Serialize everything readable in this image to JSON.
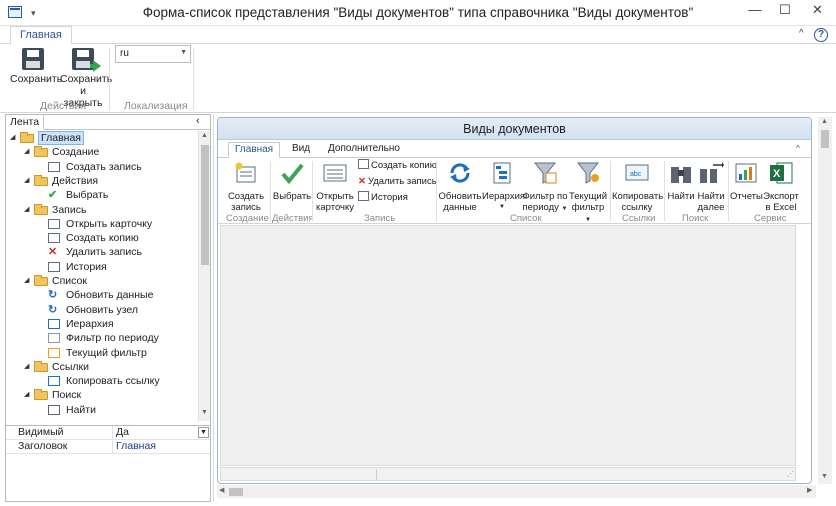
{
  "window": {
    "title": "Форма-список представления \"Виды документов\" типа справочника \"Виды документов\"",
    "minimize_glyph": "—",
    "maximize_glyph": "☐",
    "close_glyph": "✕",
    "quick_access_glyph": "▾"
  },
  "ribbon": {
    "tab_active": "Главная",
    "help_glyph": "?",
    "collapse_glyph": "^",
    "save_label": "Сохранить",
    "save_close_label_1": "Сохранить",
    "save_close_label_2": "и закрыть",
    "group_actions": "Действия",
    "lang_value": "ru",
    "group_localization": "Локализация"
  },
  "left_panel": {
    "tab_label": "Лента",
    "collapse_glyph": "‹",
    "tree": [
      {
        "label": "Главная",
        "level": 0,
        "icon": "folder-icon",
        "expanded": true,
        "selected": true
      },
      {
        "label": "Создание",
        "level": 1,
        "icon": "folder-icon",
        "expanded": true
      },
      {
        "label": "Создать запись",
        "level": 2,
        "icon": "create-record-icon"
      },
      {
        "label": "Действия",
        "level": 1,
        "icon": "folder-icon",
        "expanded": true
      },
      {
        "label": "Выбрать",
        "level": 2,
        "icon": "checkmark-icon"
      },
      {
        "label": "Запись",
        "level": 1,
        "icon": "folder-icon",
        "expanded": true
      },
      {
        "label": "Открыть карточку",
        "level": 2,
        "icon": "card-icon"
      },
      {
        "label": "Создать копию",
        "level": 2,
        "icon": "copy-icon"
      },
      {
        "label": "Удалить запись",
        "level": 2,
        "icon": "delete-icon"
      },
      {
        "label": "История",
        "level": 2,
        "icon": "history-icon"
      },
      {
        "label": "Список",
        "level": 1,
        "icon": "folder-icon",
        "expanded": true
      },
      {
        "label": "Обновить данные",
        "level": 2,
        "icon": "refresh-icon"
      },
      {
        "label": "Обновить узел",
        "level": 2,
        "icon": "refresh-icon"
      },
      {
        "label": "Иерархия",
        "level": 2,
        "icon": "hierarchy-icon"
      },
      {
        "label": "Фильтр по периоду",
        "level": 2,
        "icon": "filter-period-icon"
      },
      {
        "label": "Текущий фильтр",
        "level": 2,
        "icon": "filter-current-icon"
      },
      {
        "label": "Ссылки",
        "level": 1,
        "icon": "folder-icon",
        "expanded": true
      },
      {
        "label": "Копировать ссылку",
        "level": 2,
        "icon": "link-icon"
      },
      {
        "label": "Поиск",
        "level": 1,
        "icon": "folder-icon",
        "expanded": true
      },
      {
        "label": "Найти",
        "level": 2,
        "icon": "binoculars-icon"
      }
    ],
    "properties": [
      {
        "key": "Видимый",
        "value": "Да",
        "dropdown": true
      },
      {
        "key": "Заголовок",
        "value": "Главная",
        "dropdown": false
      }
    ]
  },
  "form": {
    "title": "Виды документов",
    "tabs": [
      "Главная",
      "Вид",
      "Дополнительно"
    ],
    "collapse_glyph": "^",
    "buttons": {
      "create_1": "Создать",
      "create_2": "запись",
      "select": "Выбрать",
      "open_1": "Открыть",
      "open_2": "карточку",
      "copy": "Создать копию",
      "delete": "Удалить запись",
      "history": "История",
      "refresh_1": "Обновить",
      "refresh_2": "данные",
      "hierarchy": "Иерархия",
      "filter_period_1": "Фильтр по",
      "filter_period_2": "периоду",
      "filter_current_1": "Текущий",
      "filter_current_2": "фильтр",
      "copy_link_1": "Копировать",
      "copy_link_2": "ссылку",
      "find": "Найти",
      "find_next_1": "Найти",
      "find_next_2": "далее",
      "reports": "Отчеты",
      "excel_1": "Экспорт",
      "excel_2": "в Excel"
    },
    "groups": {
      "creation": "Создание",
      "actions": "Действия",
      "record": "Запись",
      "list": "Список",
      "links": "Ссылки",
      "search": "Поиск",
      "service": "Сервис"
    },
    "colors": {
      "accent": "#2b579a",
      "selection": "#cce4fb",
      "excel_green": "#1d7044",
      "refresh_blue": "#1e6fc0"
    }
  }
}
